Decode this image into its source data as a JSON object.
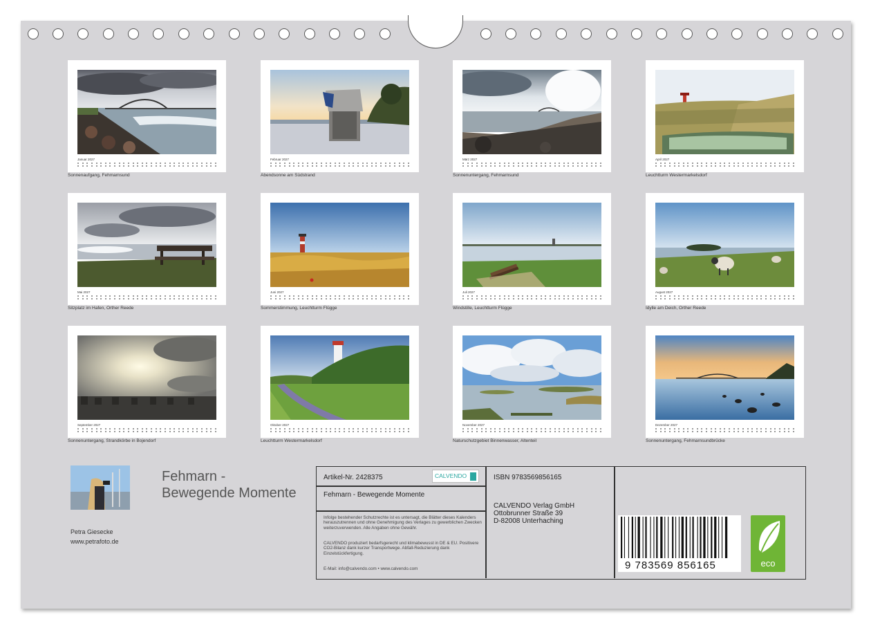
{
  "months": [
    {
      "label": "Januar 2027",
      "caption": "Sonnenaufgang, Fehmarnsund"
    },
    {
      "label": "Februar 2027",
      "caption": "Abendsonne am Südstrand"
    },
    {
      "label": "März 2027",
      "caption": "Sonnenuntergang, Fehmarnsund"
    },
    {
      "label": "April 2027",
      "caption": "Leuchtturm Westermarkelsdorf"
    },
    {
      "label": "Mai 2027",
      "caption": "Sitzplatz im Hafen, Orther Reede"
    },
    {
      "label": "Juni 2027",
      "caption": "Sommerstimmung, Leuchtturm Flügge"
    },
    {
      "label": "Juli 2027",
      "caption": "Windstille, Leuchtturm Flügge"
    },
    {
      "label": "August 2027",
      "caption": "Idylle am Deich, Orther Reede"
    },
    {
      "label": "September 2027",
      "caption": "Sonnenuntergang, Strandkörbe in Bojendorf"
    },
    {
      "label": "Oktober 2027",
      "caption": "Leuchtturm Westermarkelsdorf"
    },
    {
      "label": "November 2027",
      "caption": "Naturschutzgebiet Binnenwasser, Altenteil"
    },
    {
      "label": "Dezember 2027",
      "caption": "Sonnenuntergang, Fehmarnsundbrücke"
    }
  ],
  "author": {
    "name": "Petra Giesecke",
    "website": "www.petrafoto.de"
  },
  "title": {
    "line1": "Fehmarn -",
    "line2": "Bewegende Momente"
  },
  "info": {
    "article": "Artikel-Nr. 2428375",
    "product_title": "Fehmarn - Bewegende Momente",
    "isbn": "ISBN 9783569856165",
    "publisher_name": "CALVENDO Verlag GmbH",
    "publisher_street": "Ottobrunner Straße 39",
    "publisher_city": "D-82008 Unterhaching",
    "legal": "Infolge bestehender Schutzrechte ist es untersagt, die Blätter dieses Kalenders herauszutrennen und ohne Genehmigung des Verlages zu gewerblichen Zwecken weiterzuverwenden. Alle Angaben ohne Gewähr.",
    "eco_text": "CALVENDO produziert bedarfsgerecht und klimabewusst in DE & EU. Positivere CO2-Bilanz dank kurzer Transportwege. Abfall-Reduzierung dank Einzelstückfertigung.",
    "contact": "E-Mail: info@calvendo.com • www.calvendo.com",
    "barcode_digits": "9 783569 856165",
    "logo_text": "CALVENDO",
    "eco_label": "eco"
  },
  "colors": {
    "sheet": "#d6d5d8",
    "eco_green": "#6fb536",
    "calvendo_teal": "#2aa7a0"
  }
}
